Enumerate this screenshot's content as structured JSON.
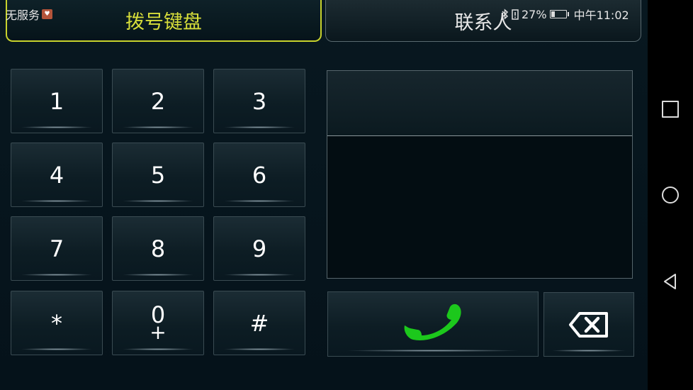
{
  "status": {
    "carrier": "无服务",
    "battery": "27%",
    "time": "中午11:02"
  },
  "tabs": {
    "dialpad": "拨号键盘",
    "contacts": "联系人"
  },
  "keys": [
    "1",
    "2",
    "3",
    "4",
    "5",
    "6",
    "7",
    "8",
    "9",
    "*",
    "0",
    "#"
  ],
  "zero_sub": "+",
  "colors": {
    "active_tab": "#d6dd3a",
    "call_icon": "#1cc81c"
  },
  "icons": {
    "call": "phone-icon",
    "delete": "backspace-icon"
  }
}
